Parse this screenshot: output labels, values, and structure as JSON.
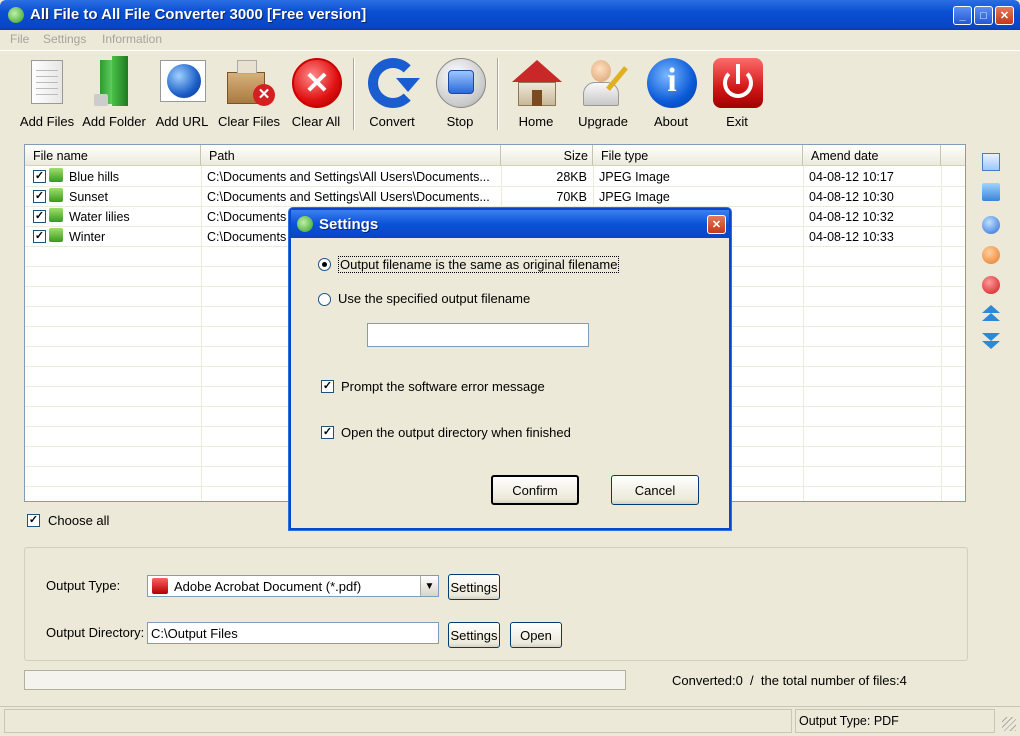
{
  "window": {
    "title": "All File to All File Converter 3000 [Free version]"
  },
  "menu": [
    "File",
    "Settings",
    "Information"
  ],
  "toolbar": {
    "add_files": "Add Files",
    "add_folder": "Add Folder",
    "add_url": "Add URL",
    "clear_files": "Clear Files",
    "clear_all": "Clear All",
    "convert": "Convert",
    "stop": "Stop",
    "home": "Home",
    "upgrade": "Upgrade",
    "about": "About",
    "exit": "Exit"
  },
  "table": {
    "columns": [
      "File name",
      "Path",
      "Size",
      "File type",
      "Amend date"
    ],
    "rows": [
      {
        "name": "Blue hills",
        "path": "C:\\Documents and Settings\\All Users\\Documents...",
        "size": "28KB",
        "type": "JPEG Image",
        "date": "04-08-12 10:17"
      },
      {
        "name": "Sunset",
        "path": "C:\\Documents and Settings\\All Users\\Documents...",
        "size": "70KB",
        "type": "JPEG Image",
        "date": "04-08-12 10:30"
      },
      {
        "name": "Water lilies",
        "path": "C:\\Documents",
        "size": "",
        "type": "",
        "date": "04-08-12 10:32"
      },
      {
        "name": "Winter",
        "path": "C:\\Documents",
        "size": "",
        "type": "",
        "date": "04-08-12 10:33"
      }
    ]
  },
  "choose_all": "Choose all",
  "output": {
    "type_label": "Output Type:",
    "type_value": "Adobe Acrobat Document (*.pdf)",
    "type_settings": "Settings",
    "dir_label": "Output Directory:",
    "dir_value": "C:\\Output Files",
    "dir_settings": "Settings",
    "open": "Open"
  },
  "progress_text": "Converted:0  /  the total number of files:4",
  "status": {
    "output_type": "Output Type: PDF"
  },
  "dialog": {
    "title": "Settings",
    "opt_same": "Output filename is the same as original filename",
    "opt_specified": "Use the specified output filename",
    "filename_value": "",
    "prompt_error": "Prompt the software error message",
    "open_dir": "Open the output directory when finished",
    "confirm": "Confirm",
    "cancel": "Cancel"
  }
}
